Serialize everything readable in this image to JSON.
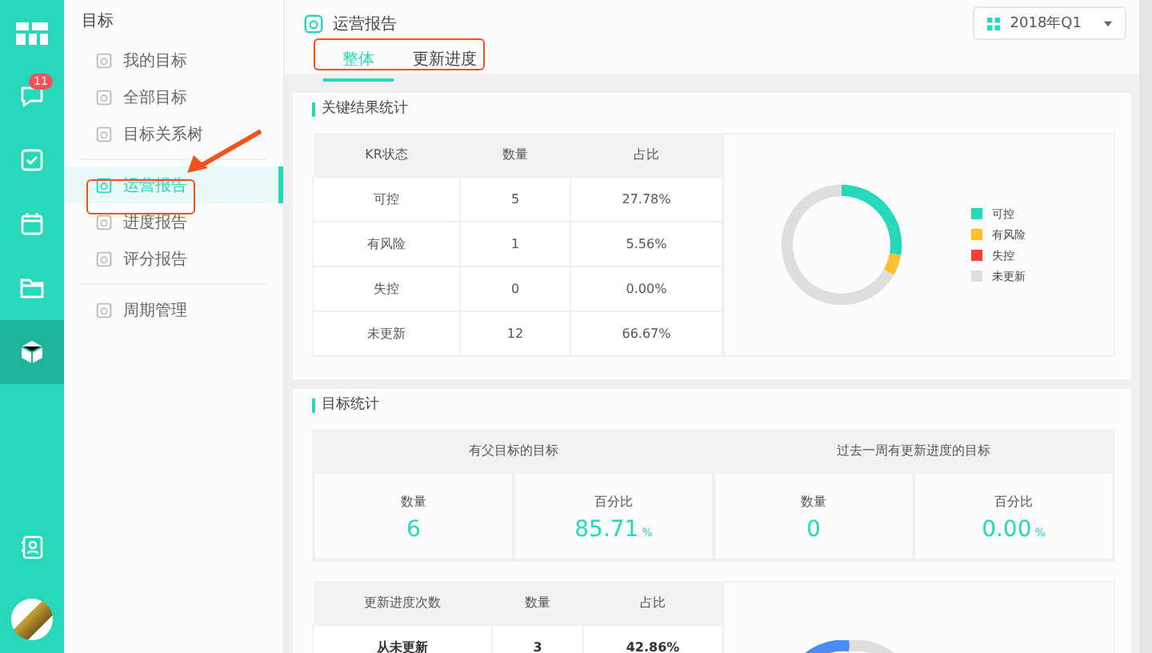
{
  "rail": {
    "badge": "11"
  },
  "sidebar": {
    "title": "目标",
    "groups": [
      [
        {
          "label": "我的目标",
          "selected": false
        },
        {
          "label": "全部目标",
          "selected": false
        },
        {
          "label": "目标关系树",
          "selected": false
        }
      ],
      [
        {
          "label": "运营报告",
          "selected": true
        },
        {
          "label": "进度报告",
          "selected": false
        },
        {
          "label": "评分报告",
          "selected": false
        }
      ],
      [
        {
          "label": "周期管理",
          "selected": false
        }
      ]
    ]
  },
  "header": {
    "title": "运营报告",
    "tabs": [
      {
        "label": "整体",
        "selected": true
      },
      {
        "label": "更新进度",
        "selected": false
      }
    ],
    "period": "2018年Q1"
  },
  "kr_card": {
    "title": "关键结果统计",
    "table": {
      "columns": [
        "KR状态",
        "数量",
        "占比"
      ],
      "rows": [
        [
          "可控",
          "5",
          "27.78%"
        ],
        [
          "有风险",
          "1",
          "5.56%"
        ],
        [
          "失控",
          "0",
          "0.00%"
        ],
        [
          "未更新",
          "12",
          "66.67%"
        ]
      ]
    },
    "legend": [
      {
        "color": "#26d7b9"
      },
      {
        "color": "#fbc02d"
      },
      {
        "color": "#f44336"
      },
      {
        "color": "#dedede"
      }
    ],
    "chart_data": {
      "type": "donut",
      "categories": [
        "可控",
        "有风险",
        "失控",
        "未更新"
      ],
      "series": [
        {
          "values": [
            27.78,
            5.56,
            0,
            66.67
          ]
        }
      ]
    }
  },
  "goal_card": {
    "title": "目标统计",
    "groups": [
      {
        "title": "有父目标的目标",
        "cells": [
          {
            "label": "数量",
            "value": "6"
          },
          {
            "label": "百分比",
            "value": "85.71",
            "unit": "%"
          }
        ]
      },
      {
        "title": "过去一周有更新进度的目标",
        "cells": [
          {
            "label": "数量",
            "value": "0"
          },
          {
            "label": "百分比",
            "value": "0.00",
            "unit": "%"
          }
        ]
      }
    ],
    "table": {
      "columns": [
        "更新进度次数",
        "数量",
        "占比"
      ],
      "rows": [
        [
          "从未更新",
          "3",
          "42.86%"
        ]
      ]
    }
  }
}
